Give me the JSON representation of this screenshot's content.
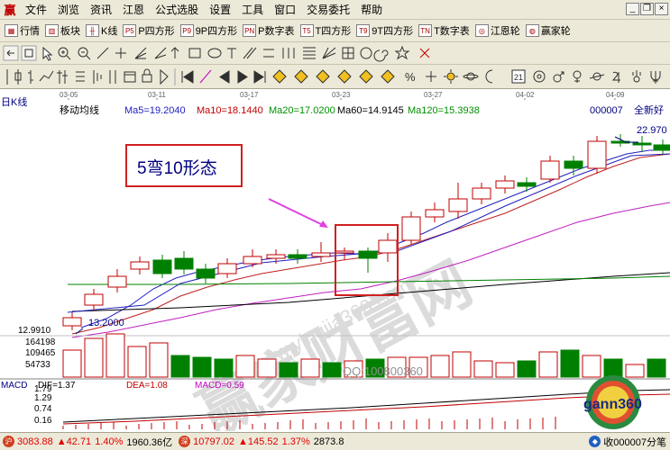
{
  "app": {
    "icon_glyph": "赢",
    "window_buttons": [
      "_",
      "❐",
      "×"
    ]
  },
  "menu": [
    "文件",
    "浏览",
    "资讯",
    "江恩",
    "公式选股",
    "设置",
    "工具",
    "窗口",
    "交易委托",
    "帮助"
  ],
  "toolbar1": [
    {
      "icon": "market-icon",
      "glyph": "▦",
      "label": "行情"
    },
    {
      "icon": "sector-icon",
      "glyph": "▥",
      "label": "板块"
    },
    {
      "icon": "kline-icon",
      "glyph": "╫",
      "label": "K线"
    },
    {
      "icon": "p-square-icon",
      "glyph": "P5",
      "label": "P四方形"
    },
    {
      "icon": "9p-square-icon",
      "glyph": "P9",
      "label": "9P四方形"
    },
    {
      "icon": "p-number-table-icon",
      "glyph": "PN",
      "label": "P数字表"
    },
    {
      "icon": "t-square-icon",
      "glyph": "T5",
      "label": "T四方形"
    },
    {
      "icon": "9t-square-icon",
      "glyph": "T9",
      "label": "9T四方形"
    },
    {
      "icon": "t-number-table-icon",
      "glyph": "TN",
      "label": "T数字表"
    },
    {
      "icon": "gann-wheel-icon",
      "glyph": "◎",
      "label": "江恩轮"
    },
    {
      "icon": "winner-wheel-icon",
      "glyph": "◍",
      "label": "赢家轮"
    }
  ],
  "chart": {
    "period_label": "日K线",
    "indicator_name": "移动均线",
    "ma": [
      {
        "label": "Ma5=19.2040",
        "color": "#2020c0"
      },
      {
        "label": "Ma10=18.1440",
        "color": "#c00000"
      },
      {
        "label": "Ma20=17.0200",
        "color": "#009000"
      },
      {
        "label": "Ma60=14.9145",
        "color": "#000000"
      },
      {
        "label": "Ma120=15.3938",
        "color": "#009000"
      }
    ],
    "stock_code": "000007",
    "stock_name": "全新好",
    "dates": [
      "03-05",
      "03-11",
      "03-17",
      "03-23",
      "03-27",
      "04-02",
      "04-09"
    ],
    "high_label": "22.970",
    "low_label": "13.2000",
    "price_axis_label": "12.9910",
    "volume_axis": [
      "164198",
      "109465",
      "54733"
    ],
    "annotation": "5弯10形态",
    "watermark": "赢家财富网",
    "watermark_url": "www.yingjia360.com",
    "qq_watermark": "QQ:100800360",
    "logo_text": "gann360",
    "colors": {
      "up": "#c00000",
      "down": "#008000",
      "ma5": "#2020c0",
      "ma10": "#c02020",
      "ma20": "#c020c0",
      "ma60": "#000000",
      "ma120": "#009000"
    }
  },
  "macd": {
    "label": "MACD",
    "dif": "DIF=1.37",
    "dea": "DEA=1.08",
    "macd": "MACD=0.59",
    "axis": [
      "1.79",
      "1.29",
      "0.74",
      "0.16"
    ]
  },
  "status": {
    "sh_index": "3083.88",
    "sh_change": "▲42.71",
    "sh_pct": "1.40%",
    "sh_amount": "1960.36亿",
    "sz_index": "10797.02",
    "sz_change": "▲145.52",
    "sz_pct": "1.37%",
    "sz_amount": "2873.8",
    "recv": "收000007分笔"
  }
}
